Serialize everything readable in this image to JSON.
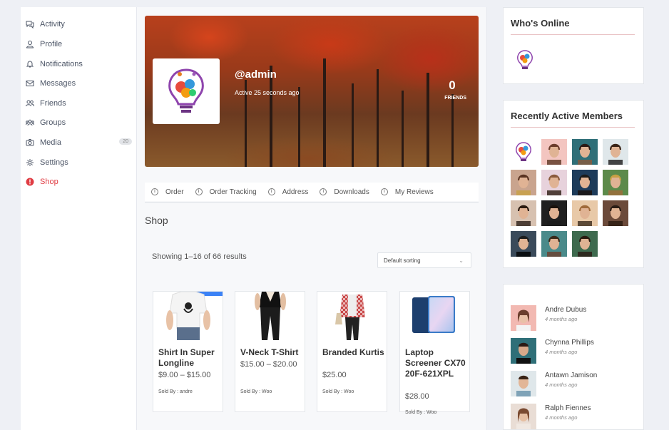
{
  "sidebar": {
    "items": [
      {
        "label": "Activity",
        "icon": "chat-icon"
      },
      {
        "label": "Profile",
        "icon": "user-icon"
      },
      {
        "label": "Notifications",
        "icon": "bell-icon"
      },
      {
        "label": "Messages",
        "icon": "envelope-icon"
      },
      {
        "label": "Friends",
        "icon": "friends-icon"
      },
      {
        "label": "Groups",
        "icon": "group-icon"
      },
      {
        "label": "Media",
        "icon": "camera-icon",
        "badge": "20"
      },
      {
        "label": "Settings",
        "icon": "gear-icon"
      },
      {
        "label": "Shop",
        "icon": "info-icon",
        "active": true
      }
    ],
    "active_color": "#e03c43"
  },
  "profile": {
    "username": "@admin",
    "active_text": "Active 25 seconds ago",
    "friends_count": "0",
    "friends_label": "FRIENDS"
  },
  "subnav": {
    "items": [
      "Order",
      "Order Tracking",
      "Address",
      "Downloads",
      "My Reviews"
    ]
  },
  "shop": {
    "title": "Shop",
    "results_text": "Showing 1–16 of 66 results",
    "sort_selected": "Default sorting",
    "products": [
      {
        "name": "Shirt In Super Longline",
        "price": "$9.00 – $15.00",
        "sold_by": "Sold By : andre"
      },
      {
        "name": "V-Neck T-Shirt",
        "price": "$15.00 – $20.00",
        "sold_by": "Sold By : Woo"
      },
      {
        "name": "Branded Kurtis",
        "price": "$25.00",
        "sold_by": "Sold By : Woo"
      },
      {
        "name": "Laptop Screener CX70 20F-621XPL",
        "price": "$28.00",
        "sold_by": "Sold By : Woo"
      }
    ]
  },
  "whos_online": {
    "title": "Who's Online"
  },
  "recently_active": {
    "title": "Recently Active Members"
  },
  "members_widget": {
    "members": [
      {
        "name": "Andre Dubus",
        "time": "4 months ago"
      },
      {
        "name": "Chynna Phillips",
        "time": "4 months ago"
      },
      {
        "name": "Antawn Jamison",
        "time": "4 months ago"
      },
      {
        "name": "Ralph Fiennes",
        "time": "4 months ago"
      }
    ]
  }
}
